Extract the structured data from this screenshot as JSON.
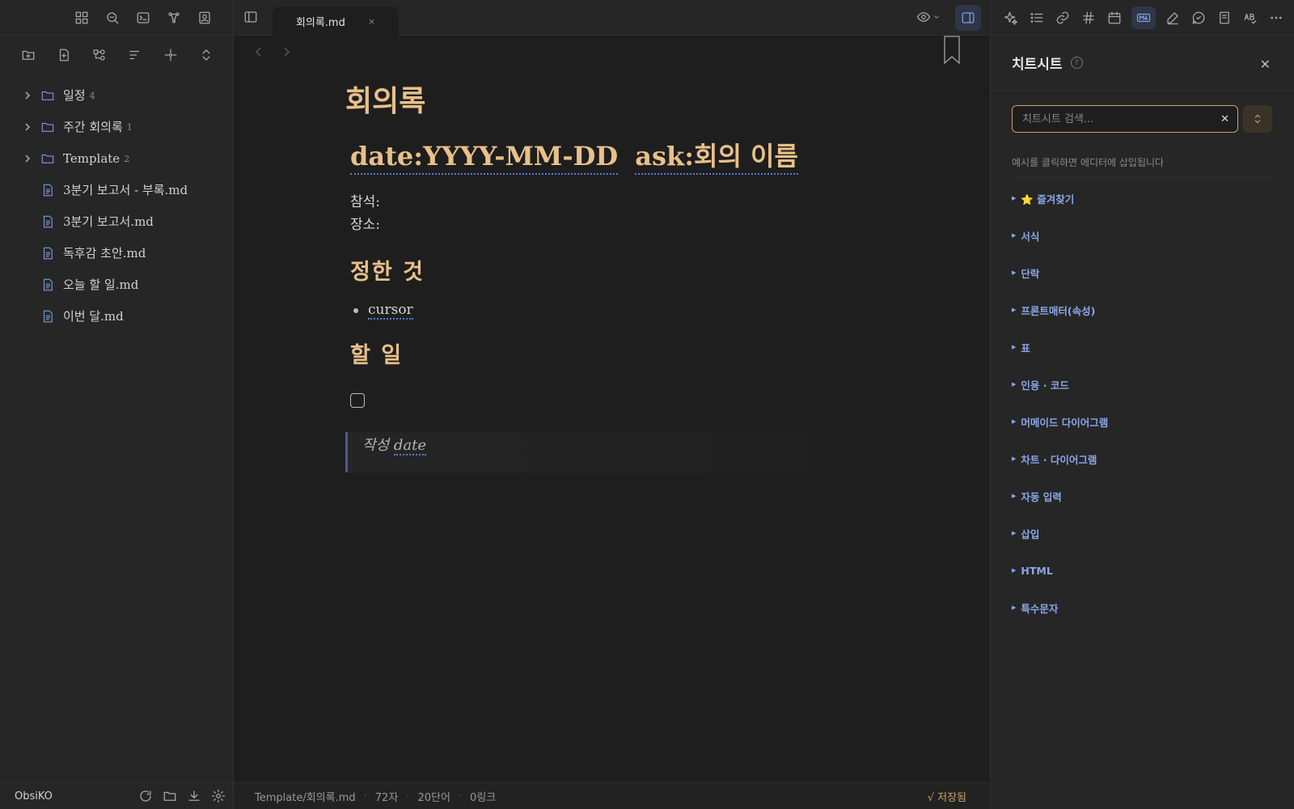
{
  "tab": {
    "title": "회의록.md",
    "close": "×"
  },
  "tree": {
    "folders": [
      {
        "name": "일정",
        "count": "4"
      },
      {
        "name": "주간 회의록",
        "count": "1"
      },
      {
        "name": "Template",
        "count": "2"
      }
    ],
    "files": [
      "3분기 보고서 - 부록.md",
      "3분기 보고서.md",
      "독후감 초안.md",
      "오늘 할 일.md",
      "이번 달.md"
    ]
  },
  "vault": {
    "name": "ObsiKO"
  },
  "doc": {
    "title": "회의록",
    "h1_part1": "date:YYYY-MM-DD",
    "h1_part2": "ask:회의 이름",
    "prop1": "참석:",
    "prop2": "장소:",
    "h2_decided": "정한 것",
    "bullet_word": "cursor",
    "h2_todo": "할 일",
    "quote_prefix": "작성",
    "quote_word": "date"
  },
  "status": {
    "path": "Template/회의록.md",
    "chars": "72자",
    "words": "20단어",
    "links": "0링크",
    "saved": "√ 저장됨"
  },
  "cheatsheet": {
    "title": "치트시트",
    "help": "?",
    "close": "✕",
    "search_placeholder": "치트시트 검색...",
    "clear": "✕",
    "hint": "예시를 클릭하면 에디터에 삽입됩니다",
    "categories": [
      "⭐ 즐겨찾기",
      "서식",
      "단락",
      "프론트매터(속성)",
      "표",
      "인용 · 코드",
      "머메이드 다이어그램",
      "차트 · 다이어그램",
      "자동 입력",
      "삽입",
      "HTML",
      "특수문자"
    ]
  }
}
